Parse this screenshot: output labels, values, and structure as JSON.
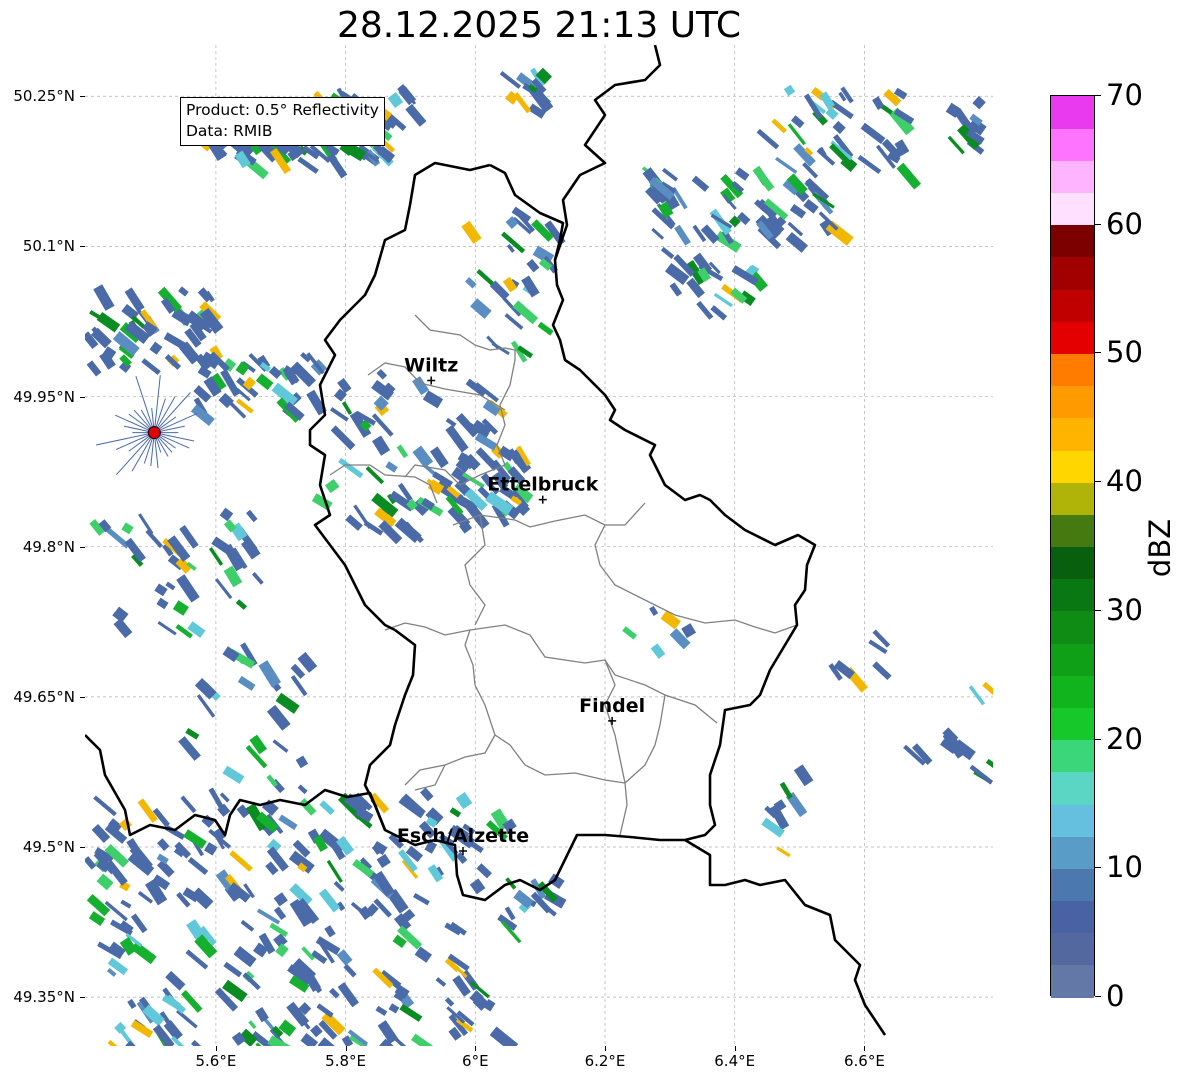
{
  "title": "28.12.2025 21:13 UTC",
  "info": {
    "product": "Product: 0.5° Reflectivity",
    "data": "Data: RMIB"
  },
  "map": {
    "lon_range": [
      5.4,
      6.8
    ],
    "lat_range": [
      49.3,
      50.3
    ],
    "radar_site": {
      "lon": 5.505,
      "lat": 49.914,
      "color": "#e00000"
    },
    "cities": [
      {
        "name": "Wiltz",
        "lon": 5.932,
        "lat": 49.966
      },
      {
        "name": "Ettelbruck",
        "lon": 6.104,
        "lat": 49.847
      },
      {
        "name": "Findel",
        "lon": 6.211,
        "lat": 49.626
      },
      {
        "name": "Esch/Alzette",
        "lon": 5.981,
        "lat": 49.496
      }
    ],
    "echo_colors": [
      "#4a6aa8",
      "#5a8ec2",
      "#60c8d8",
      "#3ecf6a",
      "#16b030",
      "#0a8c22",
      "#f2b800"
    ]
  },
  "axes": {
    "y_ticks": [
      {
        "label": "50.25°N",
        "lat": 50.25
      },
      {
        "label": "50.1°N",
        "lat": 50.1
      },
      {
        "label": "49.95°N",
        "lat": 49.95
      },
      {
        "label": "49.8°N",
        "lat": 49.8
      },
      {
        "label": "49.65°N",
        "lat": 49.65
      },
      {
        "label": "49.5°N",
        "lat": 49.5
      },
      {
        "label": "49.35°N",
        "lat": 49.35
      }
    ],
    "x_ticks": [
      {
        "label": "5.6°E",
        "lon": 5.6
      },
      {
        "label": "5.8°E",
        "lon": 5.8
      },
      {
        "label": "6°E",
        "lon": 6.0
      },
      {
        "label": "6.2°E",
        "lon": 6.2
      },
      {
        "label": "6.4°E",
        "lon": 6.4
      },
      {
        "label": "6.6°E",
        "lon": 6.6
      }
    ]
  },
  "colorbar": {
    "label": "dBZ",
    "min": 0,
    "max": 70,
    "tick_labels": [
      "0",
      "10",
      "20",
      "30",
      "40",
      "50",
      "60",
      "70"
    ],
    "colors": [
      "#6478a8",
      "#5468a0",
      "#4862a4",
      "#4c78b0",
      "#5a9cc8",
      "#64c0de",
      "#5cd6c4",
      "#3cd67a",
      "#16c82a",
      "#12b41e",
      "#10a018",
      "#0e8c14",
      "#0a7812",
      "#08600e",
      "#447a10",
      "#b0b408",
      "#ffd600",
      "#ffb400",
      "#ff9a00",
      "#ff7c00",
      "#e40000",
      "#c00000",
      "#a00000",
      "#7c0000",
      "#ffe0ff",
      "#ffb4ff",
      "#ff74ff",
      "#ea3af0"
    ]
  }
}
